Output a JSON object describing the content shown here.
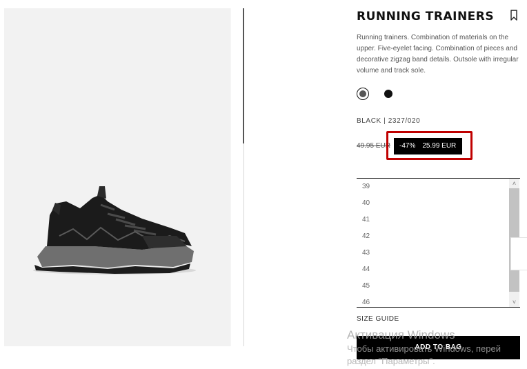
{
  "product": {
    "title": "RUNNING TRAINERS",
    "description": "Running trainers. Combination of materials on the upper. Five-eyelet facing. Combination of pieces and decorative zigzag band details. Outsole with irregular volume and track sole.",
    "color_ref": "BLACK | 2327/020",
    "old_price": "49.95 EUR",
    "discount": "-47%",
    "new_price": "25.99 EUR",
    "swatches": [
      "charcoal",
      "black"
    ]
  },
  "sizes": [
    "39",
    "40",
    "41",
    "42",
    "43",
    "44",
    "45",
    "46"
  ],
  "links": {
    "size_guide": "SIZE GUIDE"
  },
  "actions": {
    "add_to_bag": "ADD TO BAG"
  },
  "watermark": {
    "line1": "Активация Windows",
    "line2": "Чтобы активировать Windows, перей",
    "line3": "раздел \"Параметры\"."
  },
  "colors": {
    "highlight": "#c00000",
    "badge_bg": "#000000"
  }
}
